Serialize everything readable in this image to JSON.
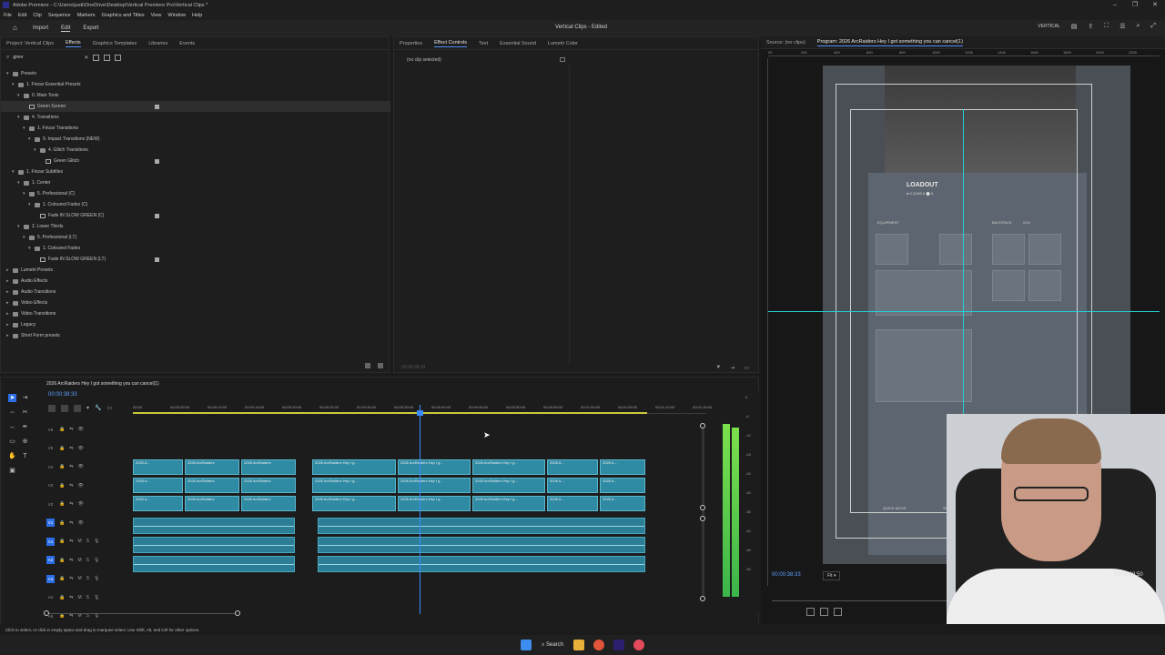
{
  "window": {
    "title": "Adobe Premiere - C:\\Users\\justi\\OneDrive\\Desktop\\Vertical Premiere Pro\\Vertical Clips *",
    "controls": [
      "–",
      "❐",
      "✕"
    ]
  },
  "menu": [
    "File",
    "Edit",
    "Clip",
    "Sequence",
    "Markers",
    "Graphics and Titles",
    "View",
    "Window",
    "Help"
  ],
  "workspace": {
    "tabs": [
      "Import",
      "Edit",
      "Export"
    ],
    "active": "Edit",
    "doc_title": "Vertical Clips - Edited",
    "right_label": "VERTICAL"
  },
  "left_panel": {
    "tabs": [
      "Project: Vertical Clips",
      "Effects",
      "Graphics Templates",
      "Libraries",
      "Events"
    ],
    "active_tab": "Effects",
    "search_value": "gree",
    "tree": [
      {
        "label": "Presets",
        "level": 0,
        "type": "folder",
        "open": true
      },
      {
        "label": "1. Finzar Essential Presets",
        "level": 1,
        "type": "folder",
        "open": true
      },
      {
        "label": "0. Main Tools",
        "level": 2,
        "type": "folder",
        "open": true
      },
      {
        "label": "Green Screen",
        "level": 3,
        "type": "fx",
        "selected": true,
        "badge": true
      },
      {
        "label": "4. Transitions",
        "level": 2,
        "type": "folder",
        "open": true
      },
      {
        "label": "1. Finzar Transitions",
        "level": 3,
        "type": "folder",
        "open": true
      },
      {
        "label": "9. Impact Transitions (NEW)",
        "level": 4,
        "type": "folder",
        "open": true
      },
      {
        "label": "4. Glitch Transitions",
        "level": 5,
        "type": "folder",
        "open": true
      },
      {
        "label": "Green Glitch",
        "level": 6,
        "type": "fx",
        "badge": true
      },
      {
        "label": "1. Finzar Subtitles",
        "level": 1,
        "type": "folder",
        "open": true
      },
      {
        "label": "1. Center",
        "level": 2,
        "type": "folder",
        "open": true
      },
      {
        "label": "5. Professional (C)",
        "level": 3,
        "type": "folder",
        "open": true
      },
      {
        "label": "1. Coloured Fades (C)",
        "level": 4,
        "type": "folder",
        "open": true
      },
      {
        "label": "Fade IN SLOW GREEN (C)",
        "level": 5,
        "type": "fx",
        "badge": true
      },
      {
        "label": "2. Lower Thirds",
        "level": 2,
        "type": "folder",
        "open": true
      },
      {
        "label": "5. Professional (LT)",
        "level": 3,
        "type": "folder",
        "open": true
      },
      {
        "label": "1. Coloured Fades",
        "level": 4,
        "type": "folder",
        "open": true
      },
      {
        "label": "Fade IN SLOW GREEN (LT)",
        "level": 5,
        "type": "fx",
        "badge": true
      },
      {
        "label": "Lumetri Presets",
        "level": 0,
        "type": "folder",
        "open": false
      },
      {
        "label": "Audio Effects",
        "level": 0,
        "type": "folder",
        "open": false
      },
      {
        "label": "Audio Transitions",
        "level": 0,
        "type": "folder",
        "open": false
      },
      {
        "label": "Video Effects",
        "level": 0,
        "type": "folder",
        "open": false
      },
      {
        "label": "Video Transitions",
        "level": 0,
        "type": "folder",
        "open": false
      },
      {
        "label": "Legacy",
        "level": 0,
        "type": "folder",
        "open": false
      },
      {
        "label": "Short Form presets",
        "level": 0,
        "type": "folder",
        "open": false
      }
    ]
  },
  "center_panel": {
    "tabs": [
      "Properties",
      "Effect Controls",
      "Text",
      "Essential Sound",
      "Lumetri Color"
    ],
    "active_tab": "Effect Controls",
    "empty_text": "(no clip selected)",
    "timecode": "00:00:38:33"
  },
  "monitor": {
    "tabs": [
      "Source: (no clips)",
      "Program: 2026 ArcRaiders Hey I got something you can cancel(1)"
    ],
    "active_tab": "Program: 2026 ArcRaiders Hey I got something you can cancel(1)",
    "ruler": [
      "00",
      "200",
      "400",
      "600",
      "800",
      "1000",
      "1200",
      "1400",
      "1600",
      "1800",
      "2000",
      "2200"
    ],
    "game_title": "LOADOUT",
    "game_sub": "● 0.21/60.0  ⬤ 0",
    "labels": [
      "EQUIPMENT",
      "BACKPACK",
      "0/15",
      "QUICK MOVE",
      "SPLIT STACK"
    ],
    "timecode_left": "00:00:38:33",
    "fit": "Fit",
    "timecode_right": "00:01:08:50"
  },
  "timeline": {
    "sequence_name": "2026 ArcRaiders Hey I got something you can cancel(1)",
    "timecode": "00:00:38:33",
    "ruler": [
      "00:00",
      "00:00:05:00",
      "00:00:10:00",
      "00:00:15:00",
      "00:00:20:00",
      "00:00:25:00",
      "00:00:30:00",
      "00:00:35:00",
      "00:00:40:00",
      "00:00:45:00",
      "00:00:50:00",
      "00:00:55:00",
      "00:01:00:00",
      "00:01:05:00",
      "00:01:10:00",
      "00:01:15:00"
    ],
    "video_tracks": [
      "V6",
      "V5",
      "V4",
      "V3",
      "V2",
      "V1"
    ],
    "audio_tracks": [
      "A1",
      "A2",
      "A3",
      "A4",
      "A5"
    ],
    "clip_label": "2026 ArcRaiders",
    "clip_label_long": "2026 ArcRaiders Hey I g...",
    "clip_label_short": "2026 A...",
    "meter_scale": [
      "0",
      "-6",
      "-12",
      "-18",
      "-24",
      "-30",
      "-36",
      "-42",
      "-48",
      "-54"
    ]
  },
  "status": "Click to select, or click in empty space and drag to marquee select. Use Shift, Alt, and Ctrl for other options.",
  "taskbar": {
    "search": "Search"
  },
  "colors": {
    "accent": "#2b6ee6",
    "clip": "#2f8aa3",
    "guide": "#1fd2d8",
    "timecode": "#5ea1ff"
  }
}
